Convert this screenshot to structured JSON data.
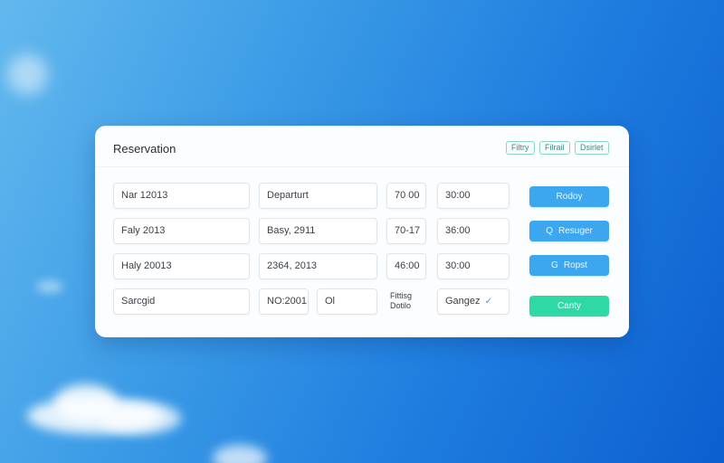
{
  "window": {
    "title": "Reservation"
  },
  "header_chips": [
    "Filtry",
    "Filrail",
    "Dsirlet"
  ],
  "rows": [
    {
      "a": "Nar 12013",
      "b": "Departurt",
      "c": "70 00",
      "d": "30:00"
    },
    {
      "a": "Faly 2013",
      "b": "Basy, 2911",
      "c": "70-17",
      "d": "36:00"
    },
    {
      "a": "Haly 20013",
      "b": "2364, 2013",
      "c": "46:00",
      "d": "30:00"
    }
  ],
  "last_row": {
    "a": "Sarcgid",
    "b1": "NO:2001",
    "b2": "Ol",
    "c_line1": "Fittisg",
    "c_line2": "Dotilo",
    "dropdown_value": "Gangez"
  },
  "buttons": [
    {
      "label": "Rodoy",
      "icon": ""
    },
    {
      "label": "Resuger",
      "icon": "search-icon"
    },
    {
      "label": "Ropst",
      "icon": "refresh-icon"
    },
    {
      "label": "Canty",
      "icon": ""
    }
  ],
  "icons": {
    "search": "Q",
    "refresh": "G",
    "chevron": "✓"
  },
  "colors": {
    "primary_button": "#3ca6ef",
    "success_button": "#2fd9a6",
    "chip_border": "#8ed4c8"
  }
}
